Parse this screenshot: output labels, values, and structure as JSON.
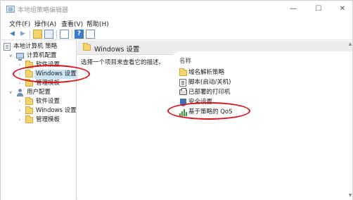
{
  "window": {
    "title": "本地组策略编辑器",
    "controls": {
      "minimize": "—",
      "maximize": "☐",
      "close": "✕"
    }
  },
  "menu": [
    "文件(F)",
    "操作(A)",
    "查看(V)",
    "帮助(H)"
  ],
  "toolbar": {
    "icons": [
      "back-icon",
      "forward-icon",
      "up-folder-icon",
      "show-hide-tree-icon",
      "export-icon",
      "help-icon",
      "properties-icon"
    ],
    "help_glyph": "?"
  },
  "tree": {
    "root": "本地计算机 策略",
    "computer_config": "计算机配置",
    "cc_software": "软件设置",
    "cc_windows": "Windows 设置",
    "cc_admin": "管理模板",
    "user_config": "用户配置",
    "uc_software": "软件设置",
    "uc_windows": "Windows 设置",
    "uc_admin": "管理模板"
  },
  "right_pane": {
    "header_title": "Windows 设置",
    "hint": "选择一个项目来查看它的描述。",
    "column_name": "名称",
    "items": [
      "域名解析策略",
      "脚本(启动/关机)",
      "已部署的打印机",
      "安全设置",
      "基于策略的 QoS"
    ]
  },
  "colors": {
    "annotation": "#d8141e",
    "selection": "#cce4f7",
    "folder": "#f5d36f",
    "header_bg": "#ececec"
  }
}
